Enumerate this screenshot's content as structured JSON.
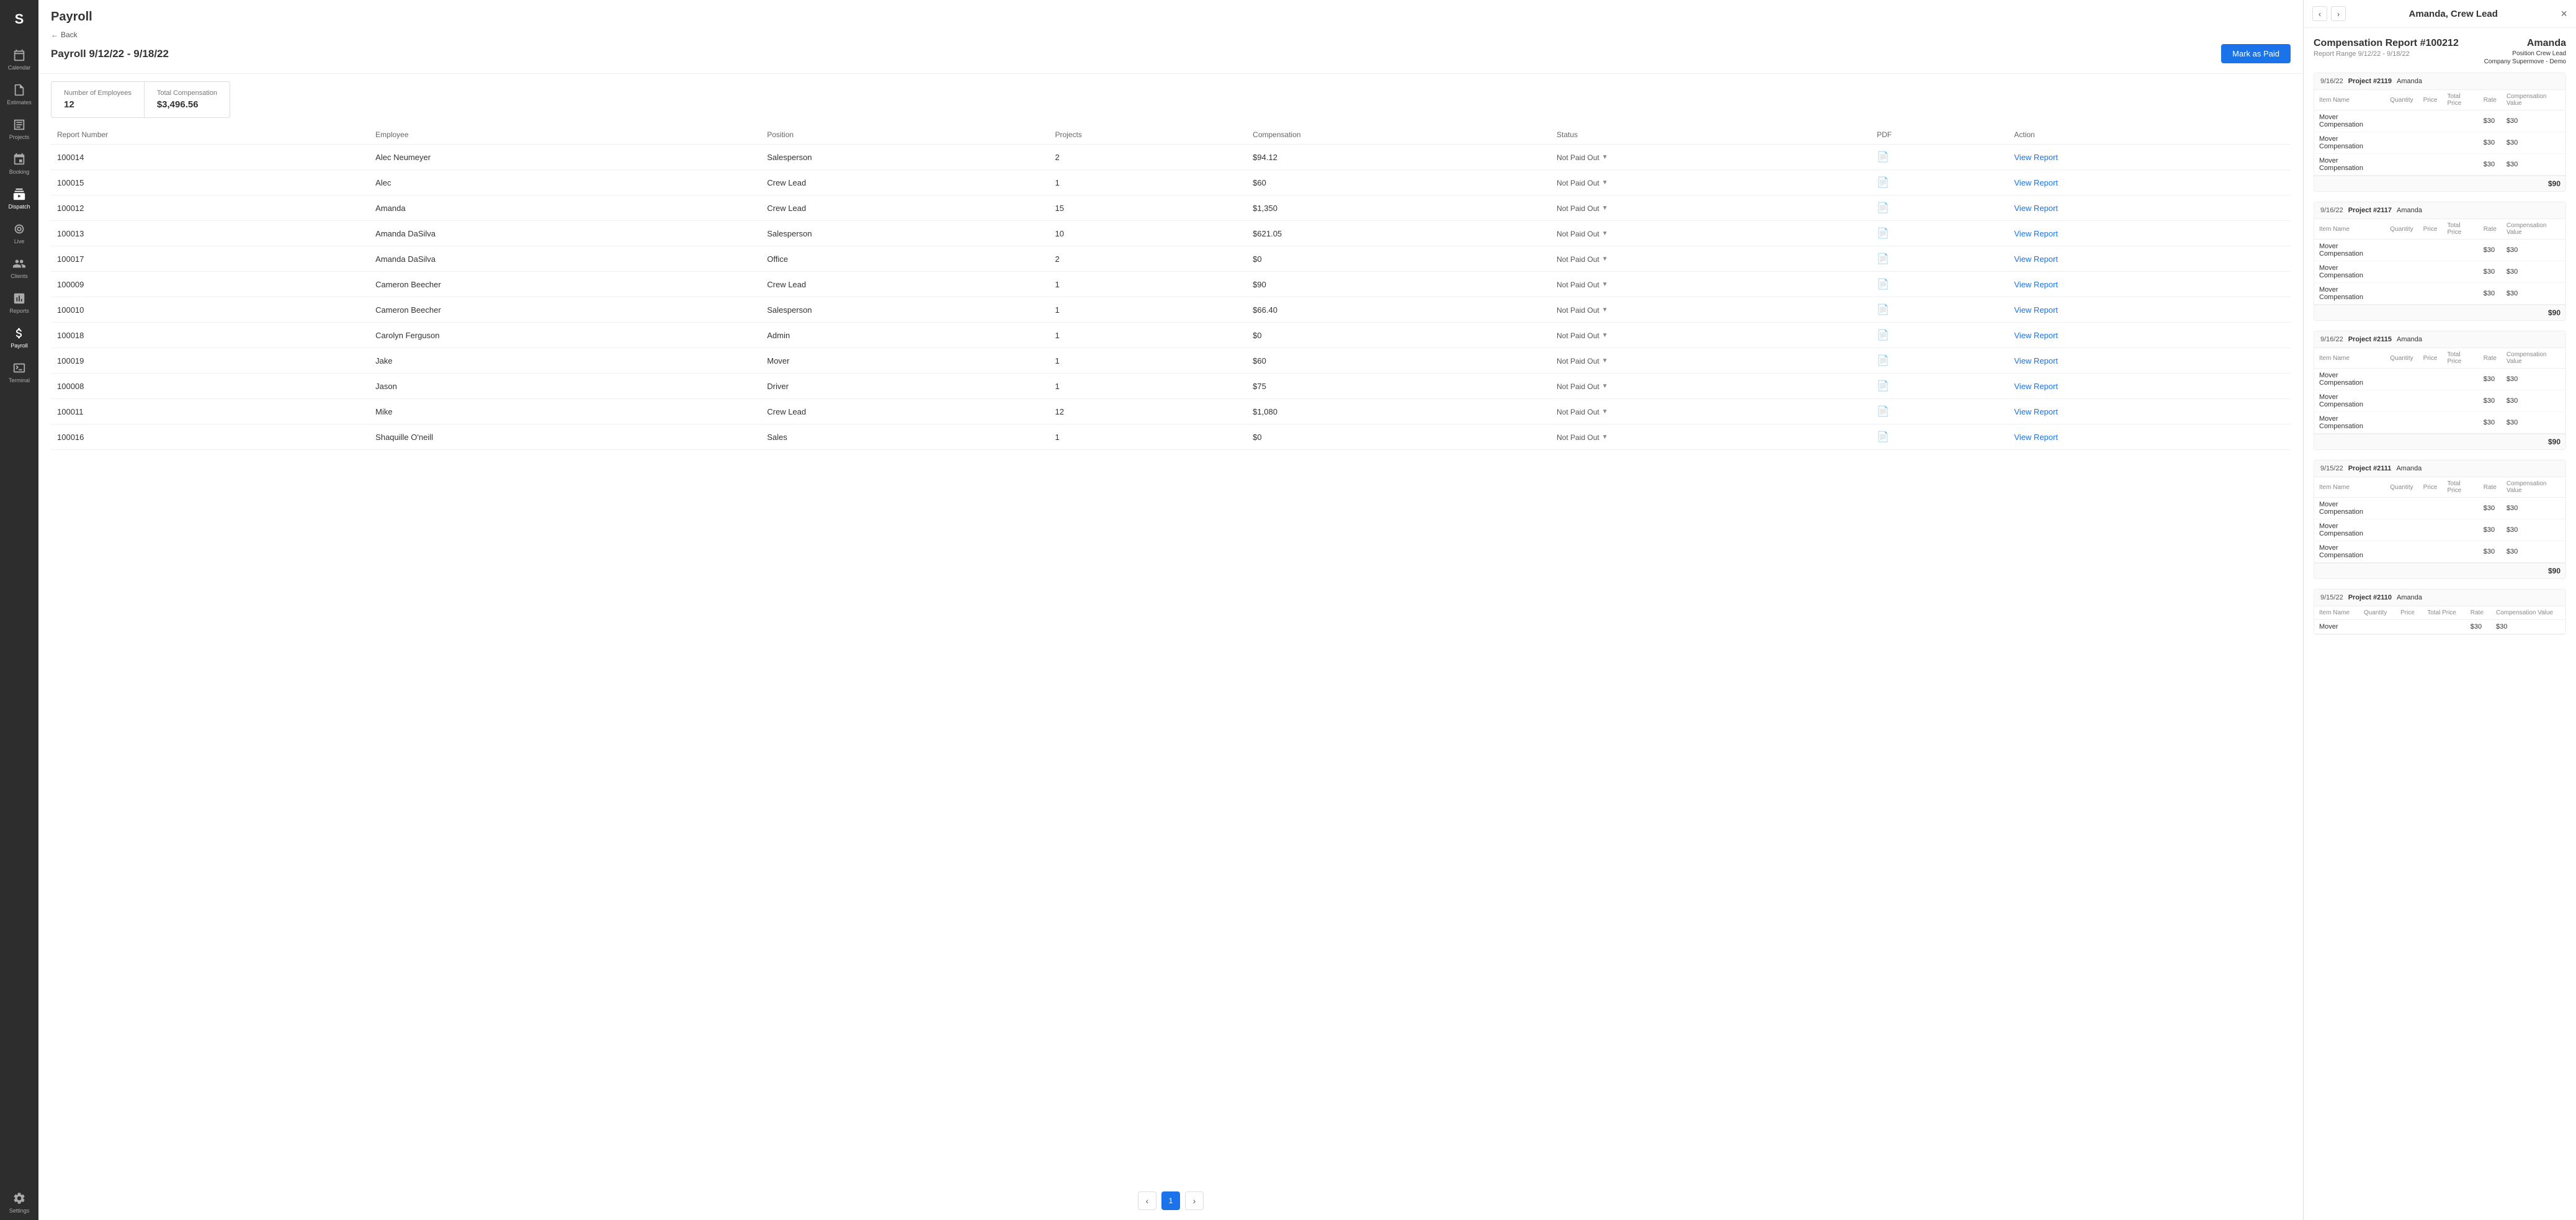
{
  "app": {
    "logo": "S"
  },
  "sidebar": {
    "items": [
      {
        "id": "calendar",
        "label": "Calendar",
        "icon": "calendar"
      },
      {
        "id": "estimates",
        "label": "Estimates",
        "icon": "estimates"
      },
      {
        "id": "projects",
        "label": "Projects",
        "icon": "projects"
      },
      {
        "id": "booking",
        "label": "Booking",
        "icon": "booking"
      },
      {
        "id": "dispatch",
        "label": "Dispatch",
        "icon": "dispatch",
        "active": true
      },
      {
        "id": "live",
        "label": "Live",
        "icon": "live"
      },
      {
        "id": "clients",
        "label": "Clients",
        "icon": "clients"
      },
      {
        "id": "reports",
        "label": "Reports",
        "icon": "reports"
      },
      {
        "id": "payroll",
        "label": "Payroll",
        "icon": "payroll",
        "active": true
      },
      {
        "id": "terminal",
        "label": "Terminal",
        "icon": "terminal"
      },
      {
        "id": "settings",
        "label": "Settings",
        "icon": "settings"
      }
    ]
  },
  "page": {
    "title": "Payroll",
    "back_label": "Back",
    "period": "Payroll 9/12/22 - 9/18/22",
    "mark_paid_label": "Mark as Paid"
  },
  "summary": {
    "num_employees_label": "Number of Employees",
    "num_employees_value": "12",
    "total_comp_label": "Total Compensation",
    "total_comp_value": "$3,496.56"
  },
  "table": {
    "columns": [
      "Report Number",
      "Employee",
      "Position",
      "Projects",
      "Compensation",
      "Status",
      "PDF",
      "Action"
    ],
    "rows": [
      {
        "report_number": "100014",
        "employee": "Alec Neumeyer",
        "position": "Salesperson",
        "projects": "2",
        "compensation": "$94.12",
        "status": "Not Paid Out",
        "action": "View Report"
      },
      {
        "report_number": "100015",
        "employee": "Alec",
        "position": "Crew Lead",
        "projects": "1",
        "compensation": "$60",
        "status": "Not Paid Out",
        "action": "View Report"
      },
      {
        "report_number": "100012",
        "employee": "Amanda",
        "position": "Crew Lead",
        "projects": "15",
        "compensation": "$1,350",
        "status": "Not Paid Out",
        "action": "View Report"
      },
      {
        "report_number": "100013",
        "employee": "Amanda DaSilva",
        "position": "Salesperson",
        "projects": "10",
        "compensation": "$621.05",
        "status": "Not Paid Out",
        "action": "View Report"
      },
      {
        "report_number": "100017",
        "employee": "Amanda DaSilva",
        "position": "Office",
        "projects": "2",
        "compensation": "$0",
        "status": "Not Paid Out",
        "action": "View Report"
      },
      {
        "report_number": "100009",
        "employee": "Cameron Beecher",
        "position": "Crew Lead",
        "projects": "1",
        "compensation": "$90",
        "status": "Not Paid Out",
        "action": "View Report"
      },
      {
        "report_number": "100010",
        "employee": "Cameron Beecher",
        "position": "Salesperson",
        "projects": "1",
        "compensation": "$66.40",
        "status": "Not Paid Out",
        "action": "View Report"
      },
      {
        "report_number": "100018",
        "employee": "Carolyn Ferguson",
        "position": "Admin",
        "projects": "1",
        "compensation": "$0",
        "status": "Not Paid Out",
        "action": "View Report"
      },
      {
        "report_number": "100019",
        "employee": "Jake",
        "position": "Mover",
        "projects": "1",
        "compensation": "$60",
        "status": "Not Paid Out",
        "action": "View Report"
      },
      {
        "report_number": "100008",
        "employee": "Jason",
        "position": "Driver",
        "projects": "1",
        "compensation": "$75",
        "status": "Not Paid Out",
        "action": "View Report"
      },
      {
        "report_number": "100011",
        "employee": "Mike",
        "position": "Crew Lead",
        "projects": "12",
        "compensation": "$1,080",
        "status": "Not Paid Out",
        "action": "View Report"
      },
      {
        "report_number": "100016",
        "employee": "Shaquille O'neill",
        "position": "Sales",
        "projects": "1",
        "compensation": "$0",
        "status": "Not Paid Out",
        "action": "View Report"
      }
    ]
  },
  "pagination": {
    "current_page": 1,
    "total_pages": 1
  },
  "right_panel": {
    "person_name": "Amanda, Crew Lead",
    "close_label": "×",
    "report_title": "Compensation Report #100212",
    "report_range_label": "Report Range",
    "report_range": "9/12/22 - 9/18/22",
    "person_display": "Amanda",
    "position_label": "Position",
    "position_value": "Crew Lead",
    "company_label": "Company",
    "company_value": "Supermove - Demo",
    "sections": [
      {
        "date": "9/16/22",
        "project": "Project #2119",
        "employee": "Amanda",
        "items": [
          {
            "name": "Mover Compensation",
            "quantity": "",
            "price": "",
            "total_price": "",
            "rate": "$30",
            "comp_value": "$30"
          },
          {
            "name": "Mover Compensation",
            "quantity": "",
            "price": "",
            "total_price": "",
            "rate": "$30",
            "comp_value": "$30"
          },
          {
            "name": "Mover Compensation",
            "quantity": "",
            "price": "",
            "total_price": "",
            "rate": "$30",
            "comp_value": "$30"
          }
        ],
        "total": "$90"
      },
      {
        "date": "9/16/22",
        "project": "Project #2117",
        "employee": "Amanda",
        "items": [
          {
            "name": "Mover Compensation",
            "quantity": "",
            "price": "",
            "total_price": "",
            "rate": "$30",
            "comp_value": "$30"
          },
          {
            "name": "Mover Compensation",
            "quantity": "",
            "price": "",
            "total_price": "",
            "rate": "$30",
            "comp_value": "$30"
          },
          {
            "name": "Mover Compensation",
            "quantity": "",
            "price": "",
            "total_price": "",
            "rate": "$30",
            "comp_value": "$30"
          }
        ],
        "total": "$90"
      },
      {
        "date": "9/16/22",
        "project": "Project #2115",
        "employee": "Amanda",
        "items": [
          {
            "name": "Mover Compensation",
            "quantity": "",
            "price": "",
            "total_price": "",
            "rate": "$30",
            "comp_value": "$30"
          },
          {
            "name": "Mover Compensation",
            "quantity": "",
            "price": "",
            "total_price": "",
            "rate": "$30",
            "comp_value": "$30"
          },
          {
            "name": "Mover Compensation",
            "quantity": "",
            "price": "",
            "total_price": "",
            "rate": "$30",
            "comp_value": "$30"
          }
        ],
        "total": "$90"
      },
      {
        "date": "9/15/22",
        "project": "Project #2111",
        "employee": "Amanda",
        "items": [
          {
            "name": "Mover Compensation",
            "quantity": "",
            "price": "",
            "total_price": "",
            "rate": "$30",
            "comp_value": "$30"
          },
          {
            "name": "Mover Compensation",
            "quantity": "",
            "price": "",
            "total_price": "",
            "rate": "$30",
            "comp_value": "$30"
          },
          {
            "name": "Mover Compensation",
            "quantity": "",
            "price": "",
            "total_price": "",
            "rate": "$30",
            "comp_value": "$30"
          }
        ],
        "total": "$90"
      },
      {
        "date": "9/15/22",
        "project": "Project #2110",
        "employee": "Amanda",
        "items": [
          {
            "name": "Mover",
            "quantity": "",
            "price": "",
            "total_price": "",
            "rate": "$30",
            "comp_value": "$30"
          }
        ],
        "total": ""
      }
    ],
    "comp_table_headers": [
      "Item Name",
      "Quantity",
      "Price",
      "Total Price",
      "Rate",
      "Compensation Value"
    ]
  }
}
